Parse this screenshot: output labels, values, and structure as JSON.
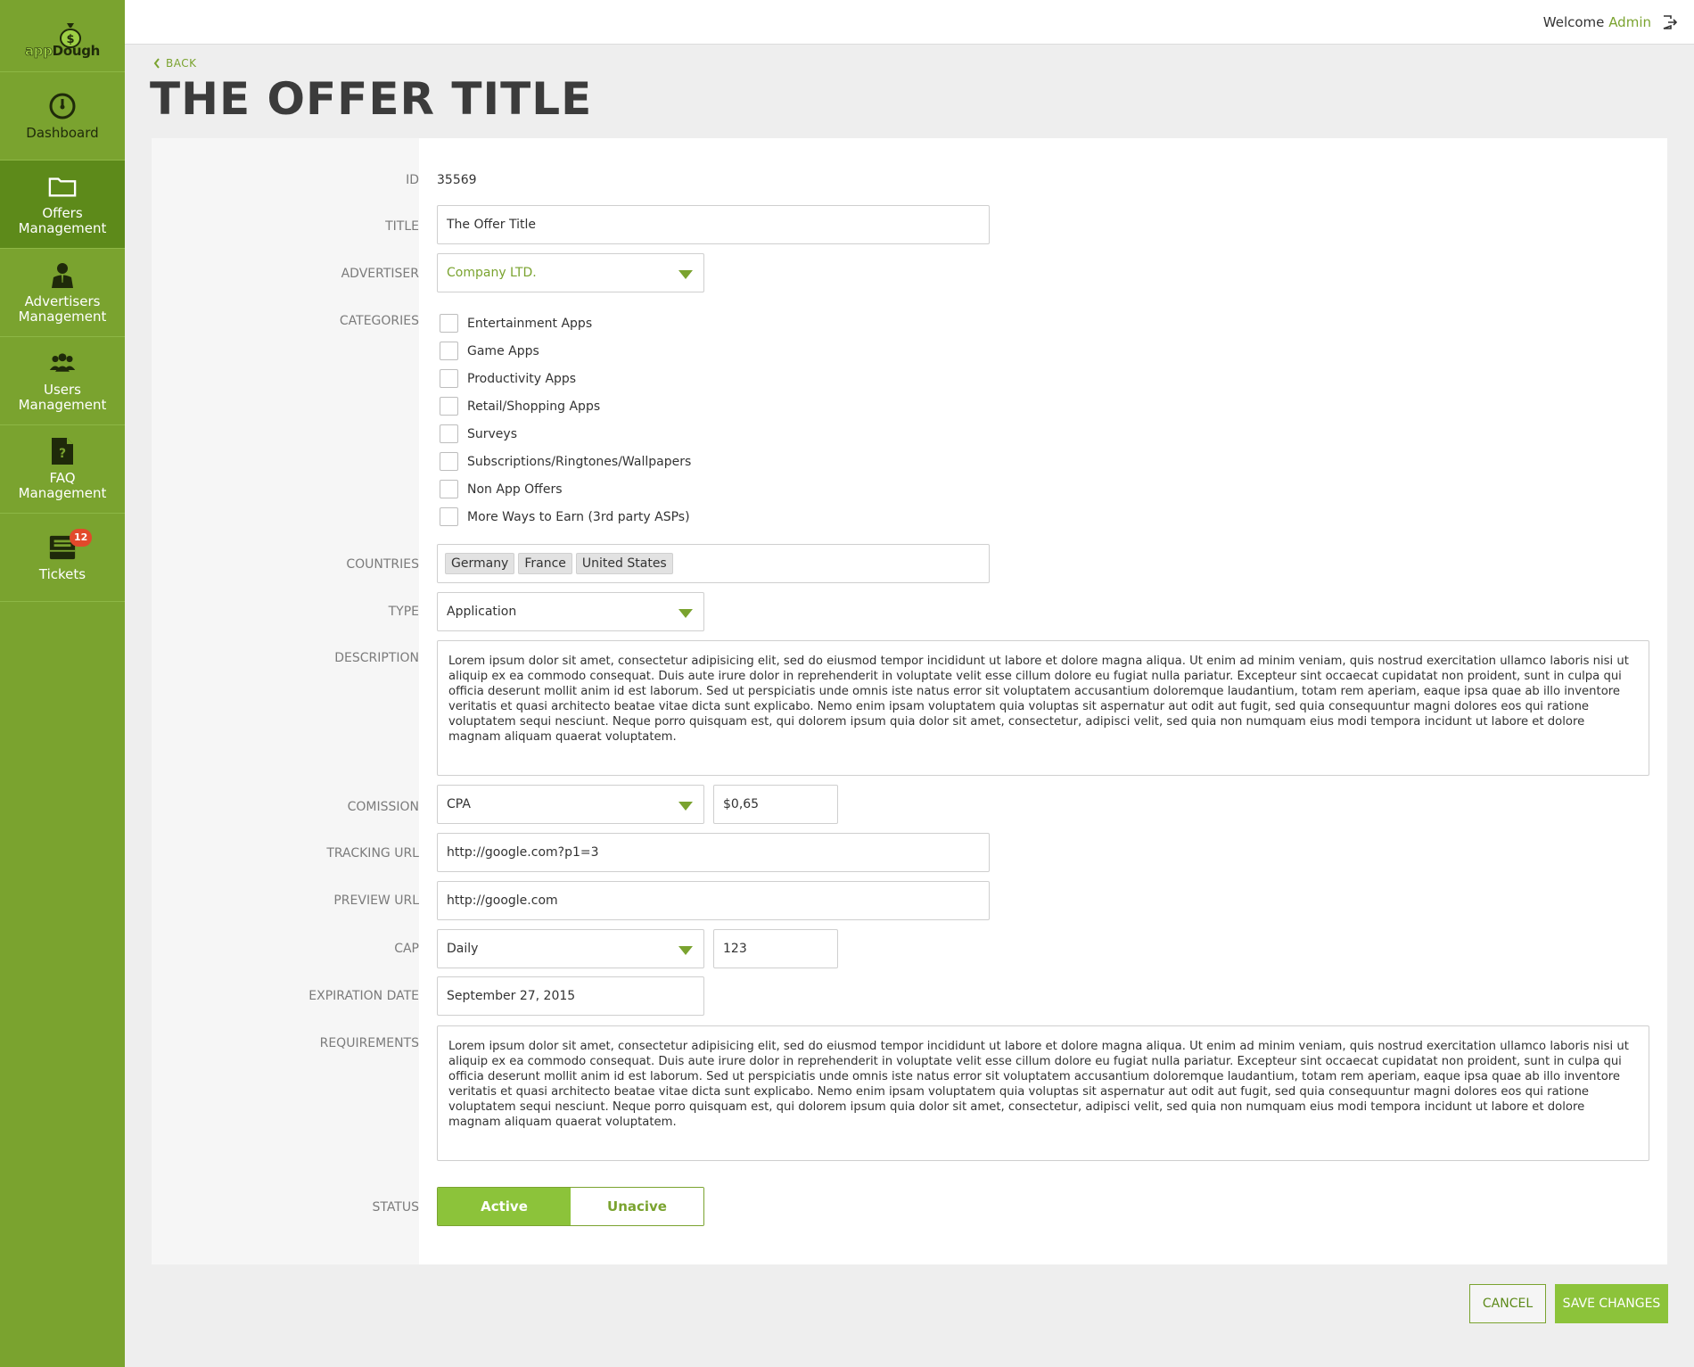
{
  "app": {
    "logo_prefix": "app",
    "logo_suffix": "Dough"
  },
  "sidebar": {
    "items": [
      {
        "label": "Dashboard",
        "icon": "gauge-icon"
      },
      {
        "label": "Offers\nManagement",
        "icon": "folder-icon"
      },
      {
        "label": "Advertisers\nManagement",
        "icon": "person-icon"
      },
      {
        "label": "Users\nManagement",
        "icon": "users-icon"
      },
      {
        "label": "FAQ\nManagement",
        "icon": "faq-document-icon"
      },
      {
        "label": "Tickets",
        "icon": "inbox-icon",
        "badge": "12"
      }
    ]
  },
  "topbar": {
    "welcome": "Welcome",
    "user": "Admin"
  },
  "header": {
    "back": "BACK",
    "title": "THE OFFER TITLE"
  },
  "form": {
    "id": {
      "label": "ID",
      "value": "35569"
    },
    "title": {
      "label": "TITLE",
      "value": "The Offer Title"
    },
    "advertiser": {
      "label": "ADVERTISER",
      "value": "Company LTD."
    },
    "categories": {
      "label": "CATEGORIES",
      "items": [
        "Entertainment Apps",
        "Game Apps",
        "Productivity Apps",
        "Retail/Shopping Apps",
        "Surveys",
        "Subscriptions/Ringtones/Wallpapers",
        "Non App Offers",
        "More Ways to Earn (3rd party ASPs)"
      ]
    },
    "countries": {
      "label": "COUNTRIES",
      "tags": [
        "Germany",
        "France",
        "United States"
      ]
    },
    "type": {
      "label": "TYPE",
      "value": "Application"
    },
    "description": {
      "label": "DESCRIPTION",
      "value": "Lorem ipsum dolor sit amet, consectetur adipisicing elit, sed do eiusmod tempor incididunt ut labore et dolore magna aliqua. Ut enim ad minim veniam, quis nostrud exercitation ullamco laboris nisi ut aliquip ex ea commodo consequat. Duis aute irure dolor in reprehenderit in voluptate velit esse cillum dolore eu fugiat nulla pariatur. Excepteur sint occaecat cupidatat non proident, sunt in culpa qui officia deserunt mollit anim id est laborum. Sed ut perspiciatis unde omnis iste natus error sit voluptatem accusantium doloremque laudantium, totam rem aperiam, eaque ipsa quae ab illo inventore veritatis et quasi architecto beatae vitae dicta sunt explicabo. Nemo enim ipsam voluptatem quia voluptas sit aspernatur aut odit aut fugit, sed quia consequuntur magni dolores eos qui ratione voluptatem sequi nesciunt. Neque porro quisquam est, qui dolorem ipsum quia dolor sit amet, consectetur, adipisci velit, sed quia non numquam eius modi tempora incidunt ut labore et dolore magnam aliquam quaerat voluptatem."
    },
    "commission": {
      "label": "COMISSION",
      "type": "CPA",
      "amount": "$0,65"
    },
    "tracking_url": {
      "label": "TRACKING URL",
      "value": "http://google.com?p1=3"
    },
    "preview_url": {
      "label": "PREVIEW URL",
      "value": "http://google.com"
    },
    "cap": {
      "label": "CAP",
      "period": "Daily",
      "amount": "123"
    },
    "expiration": {
      "label": "EXPIRATION DATE",
      "value": "September 27, 2015"
    },
    "requirements": {
      "label": "REQUIREMENTS",
      "value": "Lorem ipsum dolor sit amet, consectetur adipisicing elit, sed do eiusmod tempor incididunt ut labore et dolore magna aliqua. Ut enim ad minim veniam, quis nostrud exercitation ullamco laboris nisi ut aliquip ex ea commodo consequat. Duis aute irure dolor in reprehenderit in voluptate velit esse cillum dolore eu fugiat nulla pariatur. Excepteur sint occaecat cupidatat non proident, sunt in culpa qui officia deserunt mollit anim id est laborum. Sed ut perspiciatis unde omnis iste natus error sit voluptatem accusantium doloremque laudantium, totam rem aperiam, eaque ipsa quae ab illo inventore veritatis et quasi architecto beatae vitae dicta sunt explicabo. Nemo enim ipsam voluptatem quia voluptas sit aspernatur aut odit aut fugit, sed quia consequuntur magni dolores eos qui ratione voluptatem sequi nesciunt. Neque porro quisquam est, qui dolorem ipsum quia dolor sit amet, consectetur, adipisci velit, sed quia non numquam eius modi tempora incidunt ut labore et dolore magnam aliquam quaerat voluptatem."
    },
    "status": {
      "label": "STATUS",
      "active": "Active",
      "inactive": "Unacive"
    }
  },
  "actions": {
    "cancel": "CANCEL",
    "save": "SAVE CHANGES"
  },
  "colors": {
    "brand": "#7aa32f",
    "active_nav": "#5d8a1a",
    "accent": "#8cc33a",
    "badge": "#e2492b"
  }
}
